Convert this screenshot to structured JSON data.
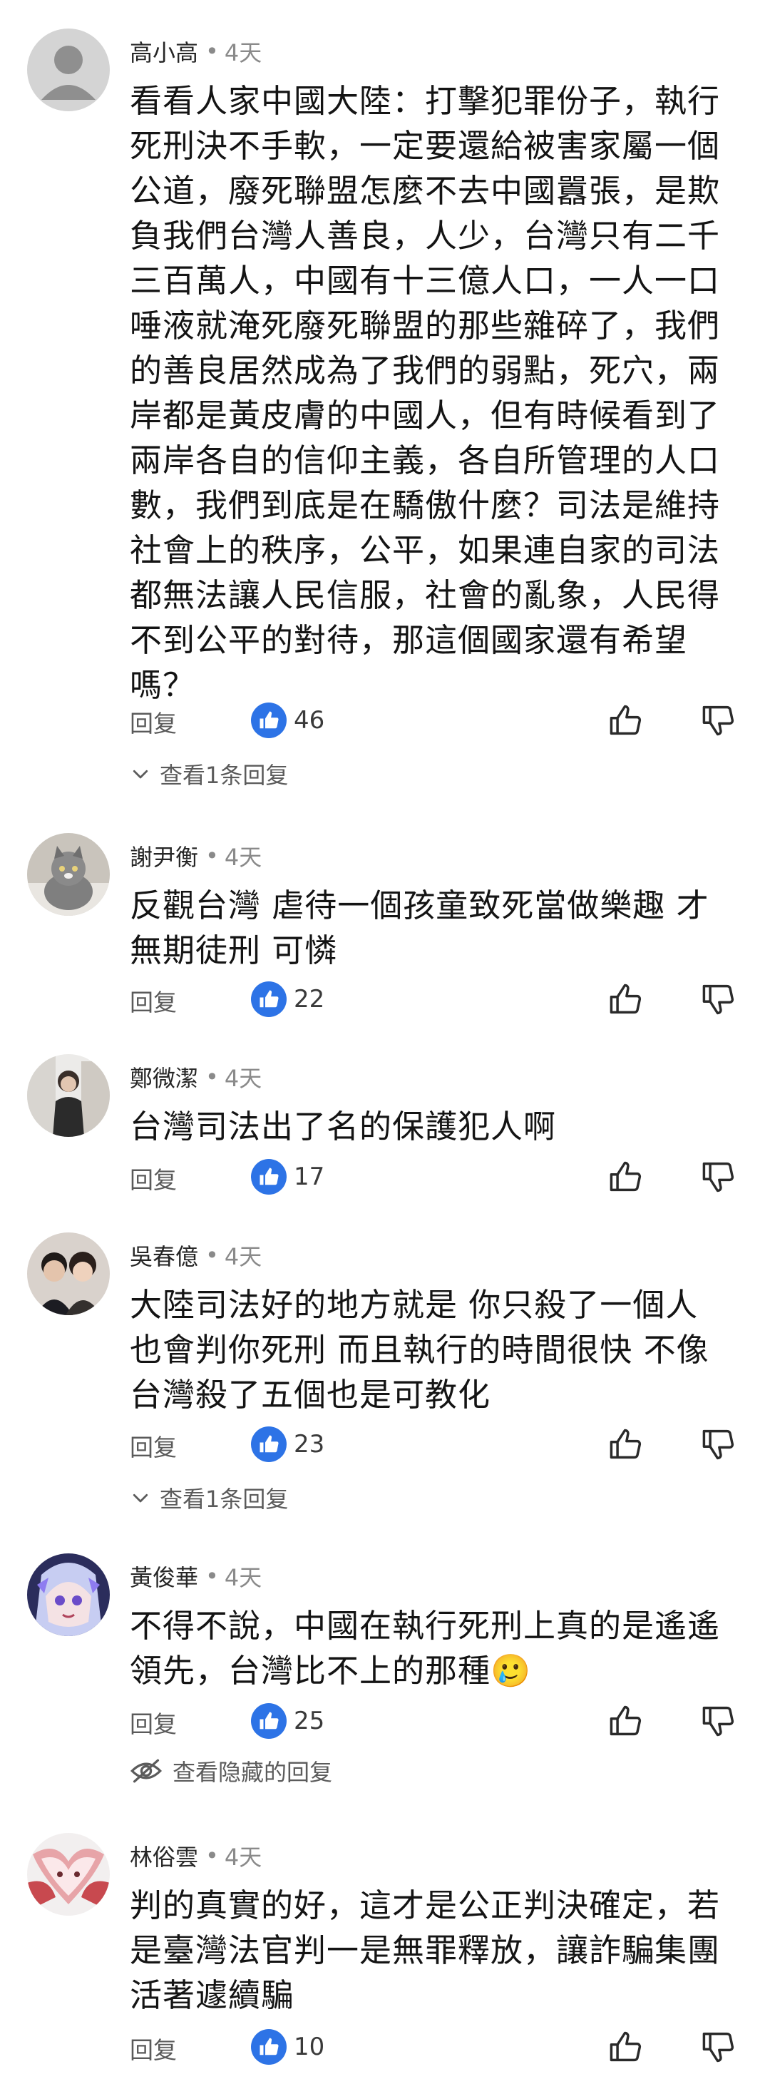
{
  "ui": {
    "reply_label": "回复",
    "accent_color": "#2d73e6"
  },
  "comments": [
    {
      "author": "高小高",
      "dot": "•",
      "time": "4天",
      "lines": [
        "看看人家中國大陸：打擊犯罪份子，執行",
        "死刑決不手軟，一定要還給被害家屬一個",
        "公道，廢死聯盟怎麼不去中國囂張，是欺",
        "負我們台灣人善良，人少，台灣只有二千",
        "三百萬人，中國有十三億人口，一人一口",
        "唾液就淹死廢死聯盟的那些雜碎了，我們",
        "的善良居然成為了我們的弱點，死穴，兩",
        "岸都是黃皮膚的中國人，但有時候看到了",
        "兩岸各自的信仰主義，各自所管理的人口",
        "數，我們到底是在驕傲什麼？司法是維持",
        "社會上的秩序，公平，如果連自家的司法",
        "都無法讓人民信服，社會的亂象，人民得",
        "不到公平的對待，那這個國家還有希望",
        "嗎？"
      ],
      "likes": "46",
      "expand": "查看1条回复",
      "avatar_icon": "default-user-avatar"
    },
    {
      "author": "謝尹衡",
      "dot": "•",
      "time": "4天",
      "lines": [
        "反觀台灣 虐待一個孩童致死當做樂趣 才",
        "無期徒刑 可憐"
      ],
      "likes": "22",
      "avatar_icon": "cat-photo-avatar"
    },
    {
      "author": "鄭微潔",
      "dot": "•",
      "time": "4天",
      "lines": [
        "台灣司法出了名的保護犯人啊"
      ],
      "likes": "17",
      "avatar_icon": "person-photo-avatar"
    },
    {
      "author": "吳春億",
      "dot": "•",
      "time": "4天",
      "lines": [
        "大陸司法好的地方就是 你只殺了一個人",
        "也會判你死刑 而且執行的時間很快 不像",
        "台灣殺了五個也是可教化"
      ],
      "likes": "23",
      "expand": "查看1条回复",
      "avatar_icon": "couple-photo-avatar"
    },
    {
      "author": "黃俊華",
      "dot": "•",
      "time": "4天",
      "lines": [
        "不得不說，中國在執行死刑上真的是遙遙",
        "領先，台灣比不上的那種🥲"
      ],
      "likes": "25",
      "hidden_link": "查看隐藏的回复",
      "avatar_icon": "anime-character-avatar"
    },
    {
      "author": "林俗雲",
      "dot": "•",
      "time": "4天",
      "lines": [
        "判的真實的好，這才是公正判決確定，若",
        "是臺灣法官判一是無罪釋放，讓詐騙集團",
        "活著遽續騙"
      ],
      "likes": "10",
      "avatar_icon": "fox-art-avatar"
    }
  ]
}
